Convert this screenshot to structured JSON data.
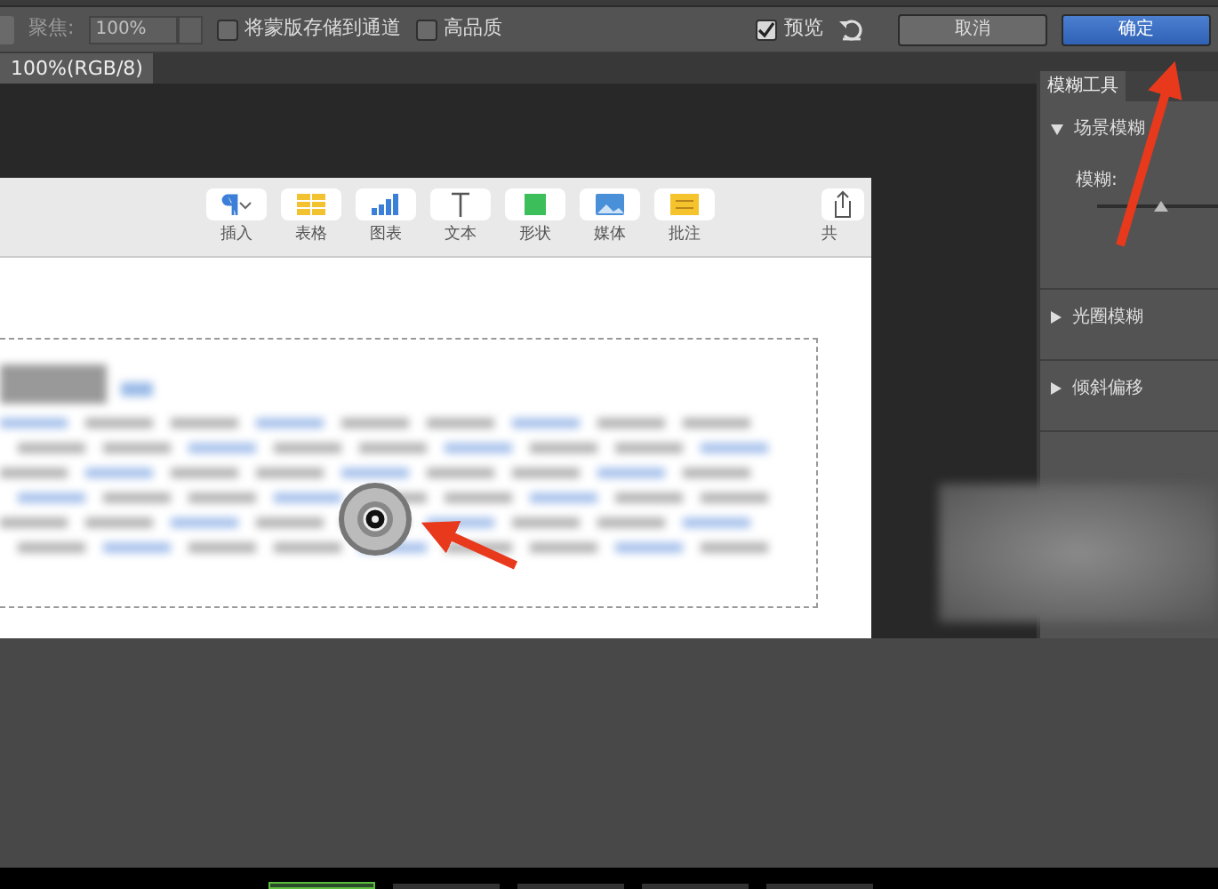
{
  "options_bar": {
    "focus": {
      "label": "聚焦:",
      "value": "100%",
      "disabled": true
    },
    "checkboxes": [
      {
        "label": "将蒙版存储到通道",
        "checked": false
      },
      {
        "label": "高品质",
        "checked": false
      },
      {
        "label": "预览",
        "checked": true
      }
    ],
    "buttons": [
      {
        "label": "取消",
        "kind": "normal"
      },
      {
        "label": "确定",
        "kind": "primary"
      }
    ]
  },
  "document_tab": {
    "label": "100%(RGB/8)"
  },
  "document_toolbar": [
    {
      "label": "插入",
      "kind": "insert"
    },
    {
      "label": "表格",
      "kind": "table"
    },
    {
      "label": "图表",
      "kind": "chart"
    },
    {
      "label": "文本",
      "kind": "text"
    },
    {
      "label": "形状",
      "kind": "shape"
    },
    {
      "label": "媒体",
      "kind": "media"
    },
    {
      "label": "批注",
      "kind": "comment"
    },
    {
      "label": "共",
      "kind": "share"
    }
  ],
  "panel": {
    "tab": "模糊工具",
    "sections": [
      {
        "title": "场景模糊",
        "expanded": true,
        "slider": {
          "label": "模糊:",
          "level": 0.5
        }
      },
      {
        "title": "光圈模糊",
        "expanded": false
      },
      {
        "title": "倾斜偏移",
        "expanded": false
      }
    ]
  }
}
